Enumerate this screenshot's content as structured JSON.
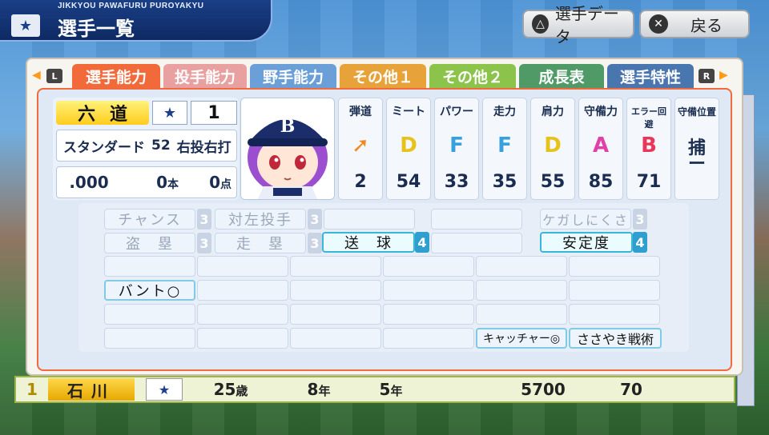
{
  "header": {
    "subtitle": "JIKKYOU PAWAFURU PUROYAKYU",
    "title": "選手一覧",
    "data_button": "選手データ",
    "back_button": "戻る"
  },
  "tabs": {
    "left_key": "L",
    "right_key": "R",
    "items": [
      {
        "label": "選手能力",
        "color": "#f26a3a"
      },
      {
        "label": "投手能力",
        "color": "#e9a0a0"
      },
      {
        "label": "野手能力",
        "color": "#6a9fd8"
      },
      {
        "label": "その他１",
        "color": "#e7a23a"
      },
      {
        "label": "その他２",
        "color": "#8cc34a"
      },
      {
        "label": "成長表",
        "color": "#4f9a66"
      },
      {
        "label": "選手特性",
        "color": "#4a76b0"
      }
    ]
  },
  "player": {
    "name": "六道",
    "number": "1",
    "type": "スタンダード",
    "age": "52",
    "handedness": "右投右打",
    "avg": ".000",
    "hr": "0",
    "hr_unit": "本",
    "rbi": "0",
    "rbi_unit": "点"
  },
  "stats": [
    {
      "label": "弾道",
      "grade": "➚",
      "value": "2",
      "color": "#f08a20"
    },
    {
      "label": "ミート",
      "grade": "D",
      "value": "54",
      "color": "#e6c21a"
    },
    {
      "label": "パワー",
      "grade": "F",
      "value": "33",
      "color": "#39a0e0"
    },
    {
      "label": "走力",
      "grade": "F",
      "value": "35",
      "color": "#39a0e0"
    },
    {
      "label": "肩力",
      "grade": "D",
      "value": "55",
      "color": "#e6c21a"
    },
    {
      "label": "守備力",
      "grade": "A",
      "value": "85",
      "color": "#e040a8"
    },
    {
      "label": "エラー回避",
      "grade": "B",
      "value": "71",
      "color": "#e8375a"
    },
    {
      "label": "守備位置",
      "grade": "捕",
      "value": "ー",
      "color": "#1a2d50"
    }
  ],
  "skills": {
    "chance": {
      "label": "チャンス",
      "level": "3"
    },
    "vs_lefty": {
      "label": "対左投手",
      "level": "3"
    },
    "injury": {
      "label": "ケガしにくさ",
      "level": "3"
    },
    "steal": {
      "label": "盗　塁",
      "level": "3"
    },
    "baserun": {
      "label": "走　塁",
      "level": "3"
    },
    "throw": {
      "label": "送　球",
      "level": "4"
    },
    "stability": {
      "label": "安定度",
      "level": "4"
    },
    "bunt": {
      "label": "バント○"
    },
    "catcher": {
      "label": "キャッチャー◎"
    },
    "whisper": {
      "label": "ささやき戦術"
    }
  },
  "roster_row": {
    "rank": "1",
    "name": "石川",
    "age": "25",
    "age_unit": "歳",
    "years1": "8",
    "years1_unit": "年",
    "years2": "5",
    "years2_unit": "年",
    "salary": "5700",
    "value": "70"
  }
}
